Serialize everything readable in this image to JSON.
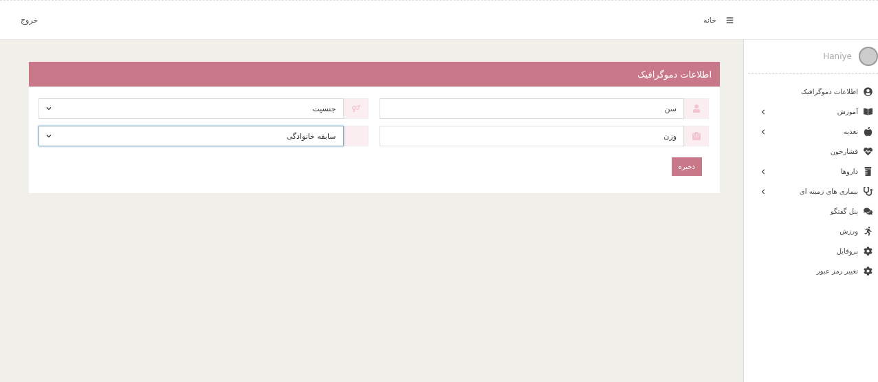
{
  "topbar": {
    "home": "خانه",
    "logout": "خروج"
  },
  "sidebar": {
    "user": "Haniye",
    "items": [
      {
        "label": "اطلاعات دموگرافیک",
        "expandable": false
      },
      {
        "label": "آموزش",
        "expandable": true
      },
      {
        "label": "تغذیه",
        "expandable": true
      },
      {
        "label": "فشارخون",
        "expandable": false
      },
      {
        "label": "داروها",
        "expandable": true
      },
      {
        "label": "بیماری های زمینه ای",
        "expandable": true
      },
      {
        "label": "پنل گفتگو",
        "expandable": false
      },
      {
        "label": "ورزش",
        "expandable": false
      },
      {
        "label": "پروفایل",
        "expandable": false
      },
      {
        "label": "تغییر رمز عبور",
        "expandable": false
      }
    ]
  },
  "card": {
    "title": "اطلاعات دموگرافیک",
    "fields": [
      {
        "kind": "input",
        "placeholder": "سن",
        "focused": false
      },
      {
        "kind": "select",
        "value": "جنسیت",
        "focused": false
      },
      {
        "kind": "input",
        "placeholder": "وزن",
        "focused": false
      },
      {
        "kind": "select",
        "value": "سابقه خانوادگی",
        "focused": true
      }
    ],
    "save": "ذخیره"
  }
}
